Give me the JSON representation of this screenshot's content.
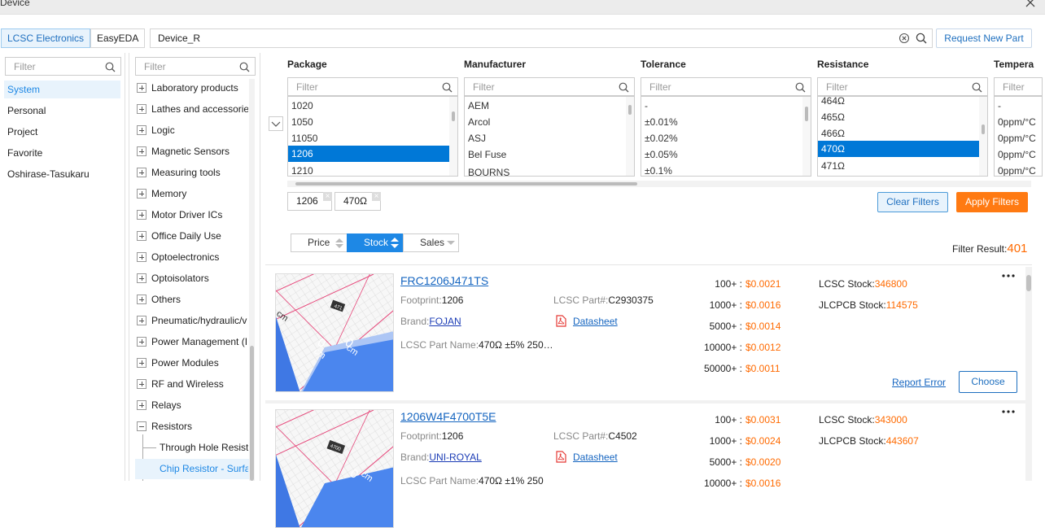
{
  "window": {
    "title": "Device"
  },
  "topbar": {
    "tabs": [
      "LCSC Electronics",
      "EasyEDA"
    ],
    "search_value": "Device_R",
    "request_label": "Request New Part"
  },
  "left": {
    "filter_placeholder": "Filter",
    "items": [
      "System",
      "Personal",
      "Project",
      "Favorite",
      "Oshirase-Tasukaru"
    ]
  },
  "categories": {
    "filter_placeholder": "Filter",
    "items": [
      "Laboratory products",
      "Lathes and accessories",
      "Logic",
      "Magnetic Sensors",
      "Measuring tools",
      "Memory",
      "Motor Driver ICs",
      "Office Daily Use",
      "Optoelectronics",
      "Optoisolators",
      "Others",
      "Pneumatic/hydraulic/v",
      "Power Management (I",
      "Power Modules",
      "RF and Wireless",
      "Relays",
      "Resistors"
    ],
    "subitems": [
      "Through Hole Resist",
      "Chip Resistor - Surfa"
    ]
  },
  "filters": {
    "placeholder": "Filter",
    "columns": [
      {
        "header": "Package",
        "options": [
          "1020",
          "1050",
          "11050",
          "1206",
          "1210"
        ],
        "selected": "1206"
      },
      {
        "header": "Manufacturer",
        "options": [
          "AEM",
          "Arcol",
          "ASJ",
          "Bel Fuse",
          "BOURNS"
        ],
        "selected": ""
      },
      {
        "header": "Tolerance",
        "options": [
          "-",
          "±0.01%",
          "±0.02%",
          "±0.05%",
          "±0.1%"
        ],
        "selected": ""
      },
      {
        "header": "Resistance",
        "options": [
          "464Ω",
          "465Ω",
          "466Ω",
          "470Ω",
          "471Ω"
        ],
        "selected": "470Ω"
      },
      {
        "header": "Tempera",
        "options": [
          "-",
          "0ppm/°C",
          "0ppm/°C",
          "0ppm/°C",
          "0ppm/°C"
        ],
        "selected": ""
      }
    ],
    "chips": [
      "1206",
      "470Ω"
    ],
    "clear_label": "Clear Filters",
    "apply_label": "Apply Filters"
  },
  "sort": {
    "price": "Price",
    "stock": "Stock",
    "sales": "Sales"
  },
  "result": {
    "label": "Filter Result:",
    "count": "401"
  },
  "colors": {
    "accent": "#1e88e5",
    "orange": "#ff7a12",
    "price": "#ff6a00"
  },
  "products": [
    {
      "name": "FRC1206J471TS",
      "footprint_label": "Footprint:",
      "footprint": "1206",
      "part_label": "LCSC Part#:",
      "part": "C2930375",
      "brand_label": "Brand:",
      "brand": "FOJAN",
      "datasheet": "Datasheet",
      "pname_label": "LCSC Part Name:",
      "pname": "470Ω ±5% 250…",
      "prices": [
        {
          "qty": "100+ :",
          "price": "$0.0021"
        },
        {
          "qty": "1000+ :",
          "price": "$0.0016"
        },
        {
          "qty": "5000+ :",
          "price": "$0.0014"
        },
        {
          "qty": "10000+ :",
          "price": "$0.0012"
        },
        {
          "qty": "50000+ :",
          "price": "$0.0011"
        }
      ],
      "lcsc_stock_label": "LCSC Stock:",
      "lcsc_stock": "346800",
      "jlc_stock_label": "JLCPCB Stock:",
      "jlc_stock": "114575",
      "report": "Report Error",
      "choose": "Choose",
      "chip_code": "471"
    },
    {
      "name": "1206W4F4700T5E",
      "footprint_label": "Footprint:",
      "footprint": "1206",
      "part_label": "LCSC Part#:",
      "part": "C4502",
      "brand_label": "Brand:",
      "brand": "UNI-ROYAL",
      "datasheet": "Datasheet",
      "pname_label": "LCSC Part Name:",
      "pname": "470Ω ±1% 250",
      "prices": [
        {
          "qty": "100+ :",
          "price": "$0.0031"
        },
        {
          "qty": "1000+ :",
          "price": "$0.0024"
        },
        {
          "qty": "5000+ :",
          "price": "$0.0020"
        },
        {
          "qty": "10000+ :",
          "price": "$0.0016"
        }
      ],
      "lcsc_stock_label": "LCSC Stock:",
      "lcsc_stock": "343000",
      "jlc_stock_label": "JLCPCB Stock:",
      "jlc_stock": "443607",
      "chip_code": "4700"
    }
  ],
  "image_labels": {
    "cm": "cm",
    "zero": "0"
  }
}
